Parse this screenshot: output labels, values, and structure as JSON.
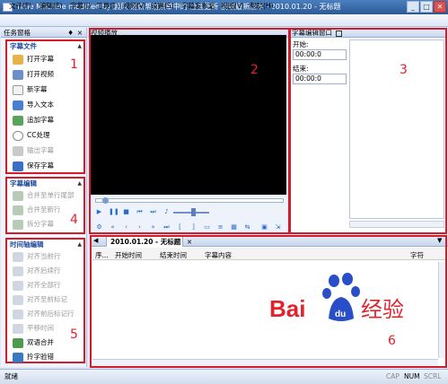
{
  "window": {
    "title": "Time Machine modified by 晨风 请点帮助菜单中的 检查更新 获取最新版本 - 2010.01.20 - 无标题"
  },
  "menu": [
    {
      "label": "文件(F)"
    },
    {
      "label": "编辑(E)"
    },
    {
      "label": "字幕(I)"
    },
    {
      "label": "工具(T)"
    },
    {
      "label": "视频(V)"
    },
    {
      "label": "设置(S)"
    },
    {
      "label": "字幕发布站"
    },
    {
      "label": "视图(V)"
    },
    {
      "label": "帮助(H)"
    }
  ],
  "task_pane": {
    "title": "任务窗格",
    "group_subtitle_file": {
      "title": "字幕文件",
      "items": [
        {
          "label": "打开字幕",
          "enabled": true,
          "icon": "open-subtitle-icon"
        },
        {
          "label": "打开视频",
          "enabled": true,
          "icon": "open-video-icon"
        },
        {
          "label": "新字幕",
          "enabled": true,
          "icon": "new-subtitle-icon"
        },
        {
          "label": "导入文本",
          "enabled": true,
          "icon": "import-text-icon"
        },
        {
          "label": "追加字幕",
          "enabled": true,
          "icon": "append-subtitle-icon"
        },
        {
          "label": "CC处理",
          "enabled": true,
          "icon": "cc-process-icon"
        },
        {
          "label": "输出字幕",
          "enabled": false,
          "icon": "export-subtitle-icon"
        },
        {
          "label": "保存字幕",
          "enabled": true,
          "icon": "save-subtitle-icon"
        }
      ]
    },
    "group_subtitle_edit": {
      "title": "字幕编辑",
      "items": [
        {
          "label": "合并至单行尾部",
          "enabled": false
        },
        {
          "label": "合并至新行",
          "enabled": false
        },
        {
          "label": "拆分字幕",
          "enabled": false
        }
      ]
    },
    "group_timeline_edit": {
      "title": "时间轴编辑",
      "items": [
        {
          "label": "对齐当前行",
          "enabled": false
        },
        {
          "label": "对齐后续行",
          "enabled": false
        },
        {
          "label": "对齐全部行",
          "enabled": false
        },
        {
          "label": "对齐至前标记",
          "enabled": false
        },
        {
          "label": "对齐前后标记行",
          "enabled": false
        },
        {
          "label": "平移时间",
          "enabled": false
        },
        {
          "label": "双语合并",
          "enabled": true
        },
        {
          "label": "拎字验错",
          "enabled": true
        }
      ]
    }
  },
  "video_panel": {
    "title": "视频播放"
  },
  "subtitle_edit_panel": {
    "title": "字幕编辑窗口",
    "start_label": "开始:",
    "start_value": "00:00:0",
    "end_label": "结束:",
    "end_value": "00:00:0"
  },
  "document": {
    "tab_label": "2010.01.20 - 无标题",
    "columns": [
      "序...",
      "开始时间",
      "结束时间",
      "字幕内容",
      "字符"
    ]
  },
  "annotations": [
    "1",
    "2",
    "3",
    "4",
    "5",
    "6"
  ],
  "watermark": {
    "text": "Bai 经验"
  },
  "statusbar": {
    "status_text": "就绪",
    "cap": "CAP",
    "num": "NUM",
    "scrl": "SCRL"
  },
  "colors": {
    "annotation_red": "#d51a2a",
    "group_title_blue": "#1d4a9a",
    "baidu_blue": "#2a4dc8",
    "baidu_red": "#e3222d"
  }
}
